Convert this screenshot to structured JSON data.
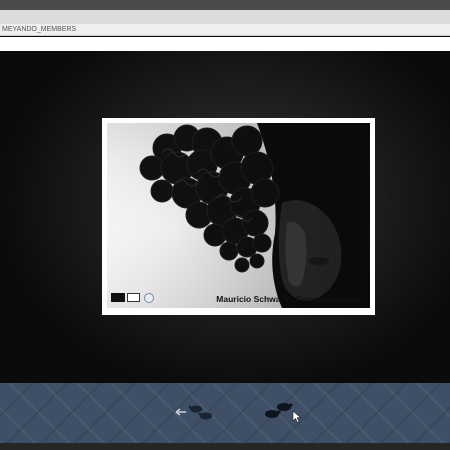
{
  "browser": {
    "address_text": "MEYANDO_MEMBERS"
  },
  "photo": {
    "caption": "Mauricio Schwarz - Consecuencias"
  },
  "nav": {
    "prev_icon": "footprints-left-icon",
    "next_icon": "footprints-right-icon"
  },
  "colors": {
    "nav_bar": "#3f5066",
    "stage": "#0c0c0c"
  }
}
